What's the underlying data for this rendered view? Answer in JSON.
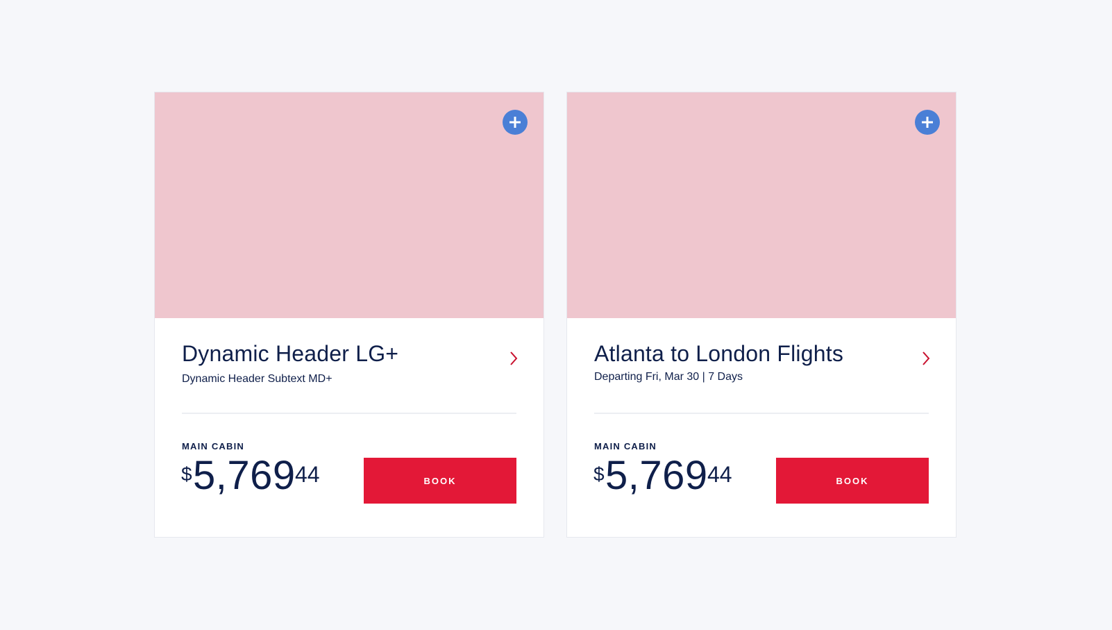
{
  "cards": [
    {
      "title": "Dynamic Header LG+",
      "subtext": "Dynamic Header Subtext MD+",
      "cabin_label": "MAIN CABIN",
      "price_currency": "$",
      "price_dollars": "5,769",
      "price_cents": "44",
      "book_label": "BOOK",
      "add_icon": "plus-icon",
      "chevron_icon": "chevron-right-icon"
    },
    {
      "title": "Atlanta to London Flights",
      "subtext": "Departing Fri, Mar 30  |  7 Days",
      "cabin_label": "MAIN CABIN",
      "price_currency": "$",
      "price_dollars": "5,769",
      "price_cents": "44",
      "book_label": "BOOK",
      "add_icon": "plus-icon",
      "chevron_icon": "chevron-right-icon"
    }
  ],
  "colors": {
    "page_background": "#f6f7fa",
    "image_placeholder": "#efc6ce",
    "add_button": "#4a7fd6",
    "book_button": "#e31837",
    "chevron": "#c8102e",
    "text_navy": "#0f1f4a"
  }
}
